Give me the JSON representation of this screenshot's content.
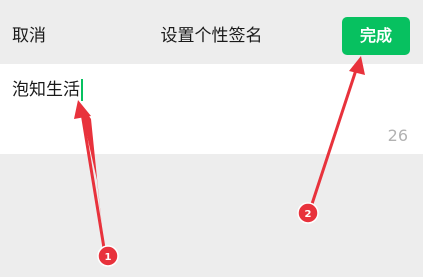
{
  "header": {
    "cancel_label": "取消",
    "title": "设置个性签名",
    "done_label": "完成"
  },
  "editor": {
    "value": "泡知生活",
    "remaining_count": "26"
  },
  "annotations": {
    "marker_1": "1",
    "marker_2": "2",
    "color": "#e8323c"
  },
  "colors": {
    "accent": "#07c160",
    "background": "#ededed",
    "counter": "#b2b2b2"
  }
}
